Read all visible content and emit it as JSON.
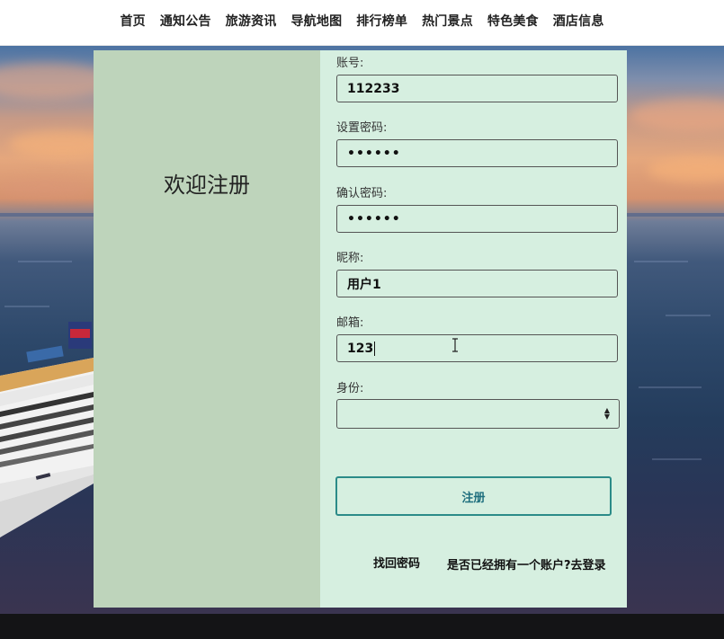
{
  "nav": {
    "items": [
      "首页",
      "通知公告",
      "旅游资讯",
      "导航地图",
      "排行榜单",
      "热门景点",
      "特色美食",
      "酒店信息"
    ]
  },
  "register": {
    "welcome": "欢迎注册",
    "fields": {
      "account_label": "账号:",
      "account_value": "112233",
      "password_label": "设置密码:",
      "password_value": "••••••",
      "confirm_label": "确认密码:",
      "confirm_value": "••••••",
      "nickname_label": "昵称:",
      "nickname_value": "用户1",
      "email_label": "邮箱:",
      "email_value": "123",
      "role_label": "身份:",
      "role_value": ""
    },
    "submit_label": "注册",
    "forgot_label": "找回密码",
    "login_label": "是否已经拥有一个账户?去登录"
  },
  "colors": {
    "left_panel": "#bed4bb",
    "right_panel": "#d6efe0",
    "button_border": "#2b8b88",
    "button_text": "#1f6f7e"
  },
  "icons": {
    "select_arrow": "select-updown-icon",
    "text_cursor": "ibeam-cursor-icon"
  }
}
